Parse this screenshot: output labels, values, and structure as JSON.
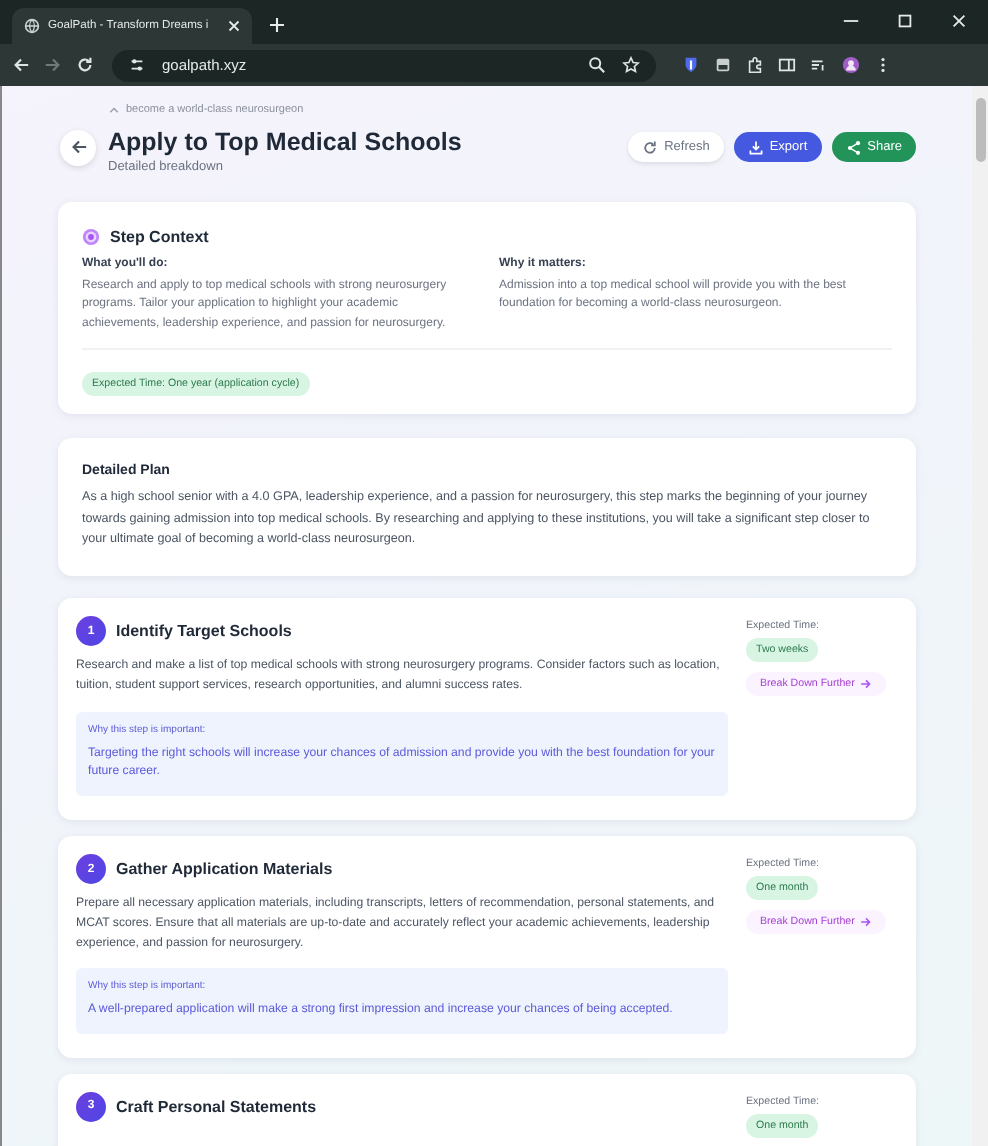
{
  "browser": {
    "tab_title": "GoalPath - Transform Dreams i",
    "url": "goalpath.xyz"
  },
  "header": {
    "breadcrumb": "become a world-class neurosurgeon",
    "title": "Apply to Top Medical Schools",
    "subtitle": "Detailed breakdown",
    "actions": [
      {
        "label": "Refresh",
        "kind": "refresh"
      },
      {
        "label": "Export",
        "kind": "export"
      },
      {
        "label": "Share",
        "kind": "share"
      }
    ]
  },
  "context": {
    "title": "Step Context",
    "what_label": "What you'll do:",
    "what_text": "Research and apply to top medical schools with strong neurosurgery programs. Tailor your application to highlight your academic achievements, leadership experience, and passion for neurosurgery.",
    "why_label": "Why it matters:",
    "why_text": "Admission into a top medical school will provide you with the best foundation for becoming a world-class neurosurgeon.",
    "expected": "Expected Time: One year (application cycle)"
  },
  "plan": {
    "title": "Detailed Plan",
    "text": "As a high school senior with a 4.0 GPA, leadership experience, and a passion for neurosurgery, this step marks the beginning of your journey towards gaining admission into top medical schools. By researching and applying to these institutions, you will take a significant step closer to your ultimate goal of becoming a world-class neurosurgeon."
  },
  "steps": [
    {
      "number": "1",
      "title": "Identify Target Schools",
      "description": "Research and make a list of top medical schools with strong neurosurgery programs. Consider factors such as location, tuition, student support services, research opportunities, and alumni success rates.",
      "why_label": "Why this step is important:",
      "why_text": "Targeting the right schools will increase your chances of admission and provide you with the best foundation for your future career.",
      "time_label": "Expected Time:",
      "time": "Two weeks",
      "action": "Break Down Further"
    },
    {
      "number": "2",
      "title": "Gather Application Materials",
      "description": "Prepare all necessary application materials, including transcripts, letters of recommendation, personal statements, and MCAT scores. Ensure that all materials are up-to-date and accurately reflect your academic achievements, leadership experience, and passion for neurosurgery.",
      "why_label": "Why this step is important:",
      "why_text": "A well-prepared application will make a strong first impression and increase your chances of being accepted.",
      "time_label": "Expected Time:",
      "time": "One month",
      "action": "Break Down Further"
    },
    {
      "number": "3",
      "title": "Craft Personal Statements",
      "time_label": "Expected Time:",
      "time": "One month"
    }
  ]
}
